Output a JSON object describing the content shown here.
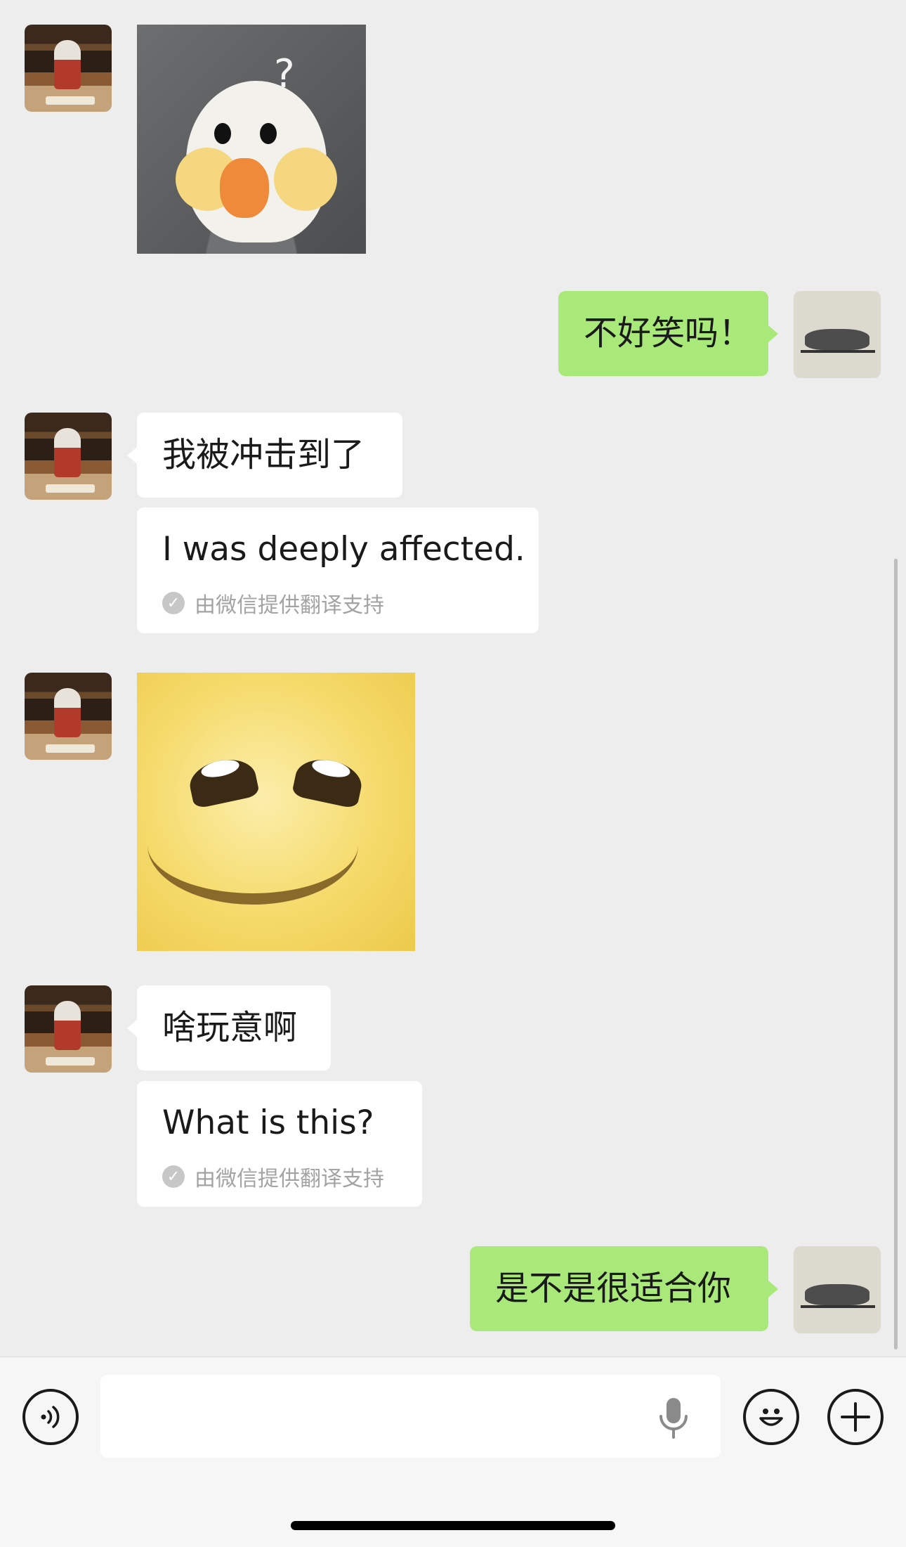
{
  "messages": {
    "m2_text": "不好笑吗！",
    "m3_text": "我被冲击到了",
    "m3_translation": "I was deeply affected.",
    "m5_text": "啥玩意啊",
    "m5_translation": "What is this?",
    "m6_text": "是不是很适合你",
    "translation_note": "由微信提供翻译支持"
  },
  "stickers": {
    "bird_question_mark": "?"
  },
  "input_bar": {
    "voice_icon": "voice-icon",
    "mic_icon": "mic-icon",
    "emoji_icon": "emoji-icon",
    "plus_icon": "plus-icon"
  },
  "colors": {
    "chat_background": "#ededed",
    "sent_bubble": "#a9e97a",
    "received_bubble": "#ffffff",
    "translation_note": "#a3a3a3"
  }
}
